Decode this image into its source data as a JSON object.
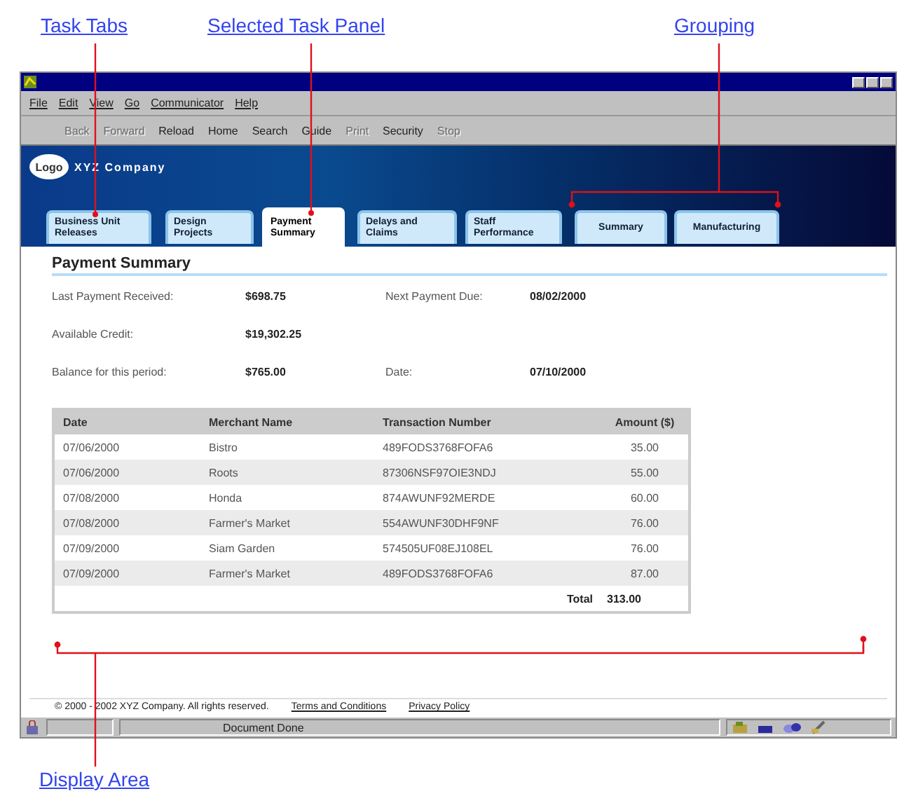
{
  "annotations": [
    {
      "label": "Task Tabs"
    },
    {
      "label": "Selected Task Panel"
    },
    {
      "label": "Grouping"
    },
    {
      "label": "Display Area"
    }
  ],
  "menu": [
    "File",
    "Edit",
    "View",
    "Go",
    "Communicator",
    "Help"
  ],
  "toolbar": [
    {
      "label": "Back",
      "disabled": true
    },
    {
      "label": "Forward",
      "disabled": true
    },
    {
      "label": "Reload",
      "disabled": false
    },
    {
      "label": "Home",
      "disabled": false
    },
    {
      "label": "Search",
      "disabled": false
    },
    {
      "label": "Guide",
      "disabled": false
    },
    {
      "label": "Print",
      "disabled": true
    },
    {
      "label": "Security",
      "disabled": false
    },
    {
      "label": "Stop",
      "disabled": true
    }
  ],
  "header": {
    "logo": "Logo",
    "company": "XYZ Company"
  },
  "tabs": [
    {
      "label": "Business Unit Releases",
      "selected": false
    },
    {
      "label": "Design Projects",
      "selected": false
    },
    {
      "label": "Payment Summary",
      "selected": true
    },
    {
      "label": "Delays and Claims",
      "selected": false
    },
    {
      "label": "Staff Performance",
      "selected": false
    },
    {
      "label": "Summary",
      "selected": false
    },
    {
      "label": "Manufacturing",
      "selected": false
    }
  ],
  "panel": {
    "title": "Payment Summary",
    "field_rows": [
      [
        {
          "label": "Last Payment Received:",
          "value": "$698.75"
        },
        {
          "label": "Next Payment Due:",
          "value": "08/02/2000"
        }
      ],
      [
        {
          "label": "Available Credit:",
          "value": "$19,302.25"
        }
      ],
      [
        {
          "label": "Balance for this period:",
          "value": "$765.00"
        },
        {
          "label": "Date:",
          "value": "07/10/2000"
        }
      ]
    ]
  },
  "table": {
    "columns": [
      "Date",
      "Merchant Name",
      "Transaction Number",
      "Amount ($)"
    ],
    "rows": [
      [
        "07/06/2000",
        "Bistro",
        "489FODS3768FOFA6",
        "35.00"
      ],
      [
        "07/06/2000",
        "Roots",
        "87306NSF97OIE3NDJ",
        "55.00"
      ],
      [
        "07/08/2000",
        "Honda",
        "874AWUNF92MERDE",
        "60.00"
      ],
      [
        "07/08/2000",
        "Farmer's Market",
        "554AWUNF30DHF9NF",
        "76.00"
      ],
      [
        "07/09/2000",
        "Siam Garden",
        "574505UF08EJ108EL",
        "76.00"
      ],
      [
        "07/09/2000",
        "Farmer's Market",
        "489FODS3768FOFA6",
        "87.00"
      ]
    ],
    "total_label": "Total",
    "total_value": "313.00"
  },
  "footer": {
    "copyright": "© 2000 - 2002 XYZ Company. All rights reserved.",
    "links": [
      "Terms and Conditions",
      "Privacy Policy"
    ]
  },
  "status_bar": {
    "text": "Document Done"
  }
}
